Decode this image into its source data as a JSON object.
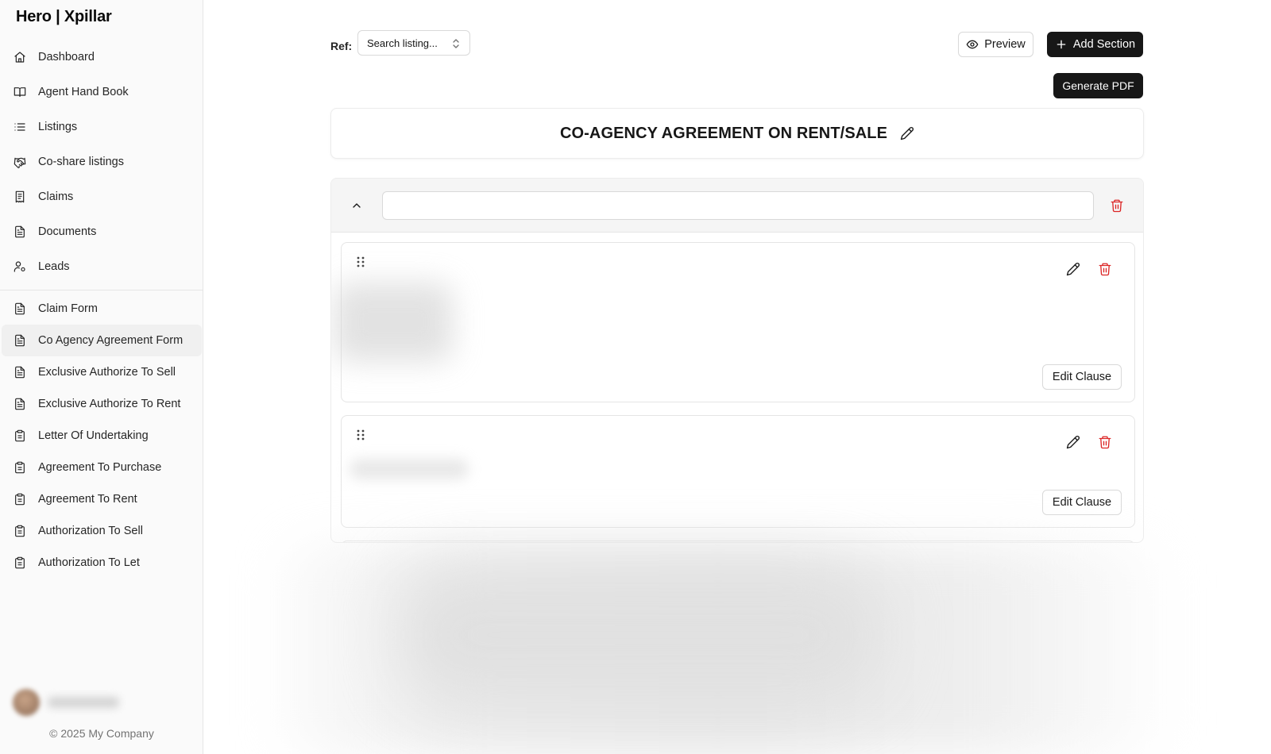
{
  "sidebar": {
    "brand": "Hero | Xpillar",
    "primary_items": [
      {
        "label": "Dashboard",
        "icon": "home-icon"
      },
      {
        "label": "Agent Hand Book",
        "icon": "book-icon"
      },
      {
        "label": "Listings",
        "icon": "list-icon"
      },
      {
        "label": "Co-share listings",
        "icon": "handshake-icon"
      },
      {
        "label": "Claims",
        "icon": "receipt-icon"
      },
      {
        "label": "Documents",
        "icon": "document-icon"
      },
      {
        "label": "Leads",
        "icon": "user-cog-icon"
      }
    ],
    "form_items": [
      {
        "label": "Claim Form",
        "icon": "document-icon"
      },
      {
        "label": "Co Agency Agreement Form",
        "icon": "document-icon",
        "active": true
      },
      {
        "label": "Exclusive Authorize To Sell",
        "icon": "document-icon"
      },
      {
        "label": "Exclusive Authorize To Rent",
        "icon": "document-icon"
      },
      {
        "label": "Letter Of Undertaking",
        "icon": "clipboard-icon"
      },
      {
        "label": "Agreement To Purchase",
        "icon": "clipboard-icon"
      },
      {
        "label": "Agreement To Rent",
        "icon": "clipboard-icon"
      },
      {
        "label": "Authorization To Sell",
        "icon": "clipboard-icon"
      },
      {
        "label": "Authorization To Let",
        "icon": "clipboard-icon"
      }
    ],
    "footer": "© 2025 My Company"
  },
  "toolbar": {
    "ref_label": "Ref:",
    "ref_placeholder": "Search listing...",
    "preview_label": "Preview",
    "add_section_label": "Add Section",
    "generate_pdf_label": "Generate PDF"
  },
  "document": {
    "title": "CO-AGENCY AGREEMENT ON RENT/SALE"
  },
  "section": {
    "title_value": "",
    "clauses": [
      {
        "edit_label": "Edit Clause"
      },
      {
        "edit_label": "Edit Clause"
      }
    ]
  },
  "colors": {
    "accent_dark": "#171717",
    "danger": "#dc2626",
    "sidebar_bg": "#fafafa"
  }
}
